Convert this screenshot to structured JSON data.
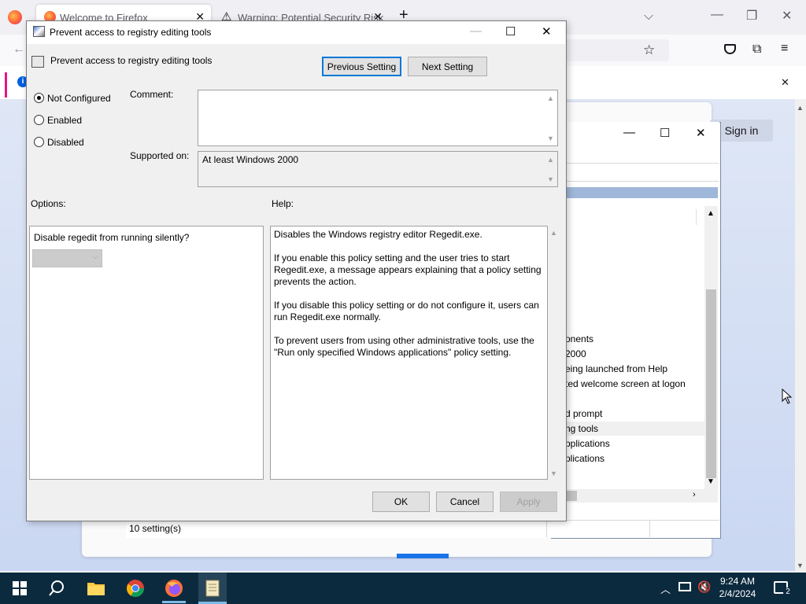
{
  "firefox": {
    "tabs": [
      {
        "label": "Welcome to Firefox"
      },
      {
        "label": "Warning: Potential Security Risk"
      }
    ],
    "new_tab_symbol": "+",
    "sign_in_label": "Sign in"
  },
  "gpedit": {
    "list_items": [
      "onents",
      "2000",
      "eing launched from Help",
      "ted welcome screen at logon",
      "d prompt",
      "ng tools",
      "pplications",
      "plications"
    ],
    "status_text": "10 setting(s)"
  },
  "dialog": {
    "window_title": "Prevent access to registry editing tools",
    "policy_title": "Prevent access to registry editing tools",
    "previous_label": "Previous Setting",
    "next_label": "Next Setting",
    "radio_not_configured": "Not Configured",
    "radio_enabled": "Enabled",
    "radio_disabled": "Disabled",
    "selected_state": "Not Configured",
    "comment_label": "Comment:",
    "comment_value": "",
    "supported_label": "Supported on:",
    "supported_value": "At least Windows 2000",
    "options_label": "Options:",
    "help_label": "Help:",
    "option_question": "Disable regedit from running silently?",
    "option_select_value": "",
    "help_text": "Disables the Windows registry editor Regedit.exe.\n\nIf you enable this policy setting and the user tries to start Regedit.exe, a message appears explaining that a policy setting prevents the action.\n\nIf you disable this policy setting or do not configure it, users can run Regedit.exe normally.\n\nTo prevent users from using other administrative tools, use the \"Run only specified Windows applications\" policy setting.",
    "ok_label": "OK",
    "cancel_label": "Cancel",
    "apply_label": "Apply"
  },
  "taskbar": {
    "time": "9:24 AM",
    "date": "2/4/2024",
    "notification_count": "2"
  },
  "colors": {
    "dialog_bg": "#f0f0f0",
    "taskbar_bg": "#0c2a3e",
    "focus_blue": "#0078d7",
    "header_blue": "#9fb7d9"
  }
}
